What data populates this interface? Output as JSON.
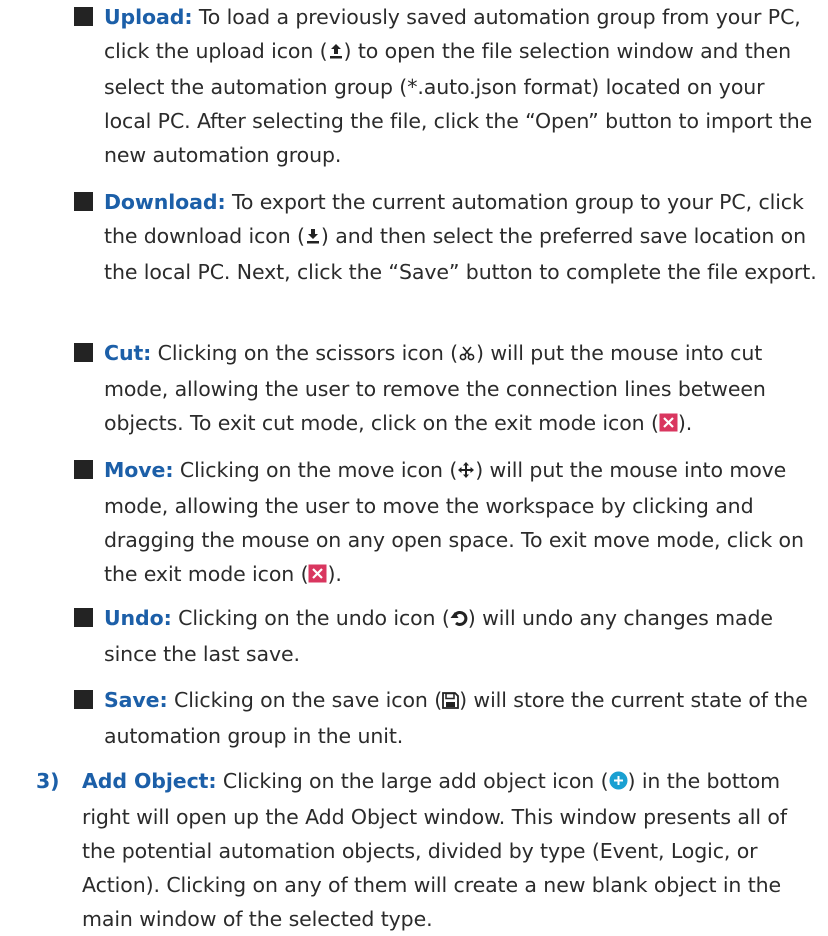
{
  "items": [
    {
      "term": "Upload:",
      "text_before": " To load a previously saved automation group from your PC, click the upload icon (",
      "text_after": ") to open the file selection window and then select the automation group (*.auto.json format) located on your local PC. After selecting the file, click the “Open” button to import the new automation group.",
      "icon": "upload-icon"
    },
    {
      "term": "Download:",
      "text_before": " To export the current automation group to your PC, click the download icon (",
      "text_after": ") and then select the preferred save location on the local PC. Next, click the “Save” button to complete the file export.",
      "icon": "download-icon"
    },
    {
      "term": "Cut:",
      "text_before": " Clicking on the scissors icon (",
      "text_mid": ") will put the mouse into cut mode, allowing the user to remove the connection lines between objects. To exit cut mode, click on the exit mode icon (",
      "text_after": ").",
      "icon": "scissors-icon",
      "icon2": "exit-mode-icon"
    },
    {
      "term": "Move:",
      "text_before": " Clicking on the move icon (",
      "text_mid": ") will put the mouse into move mode, allowing the user to move the workspace by clicking and dragging the mouse on any open space. To exit move mode, click on the exit mode icon (",
      "text_after": ").",
      "icon": "move-icon",
      "icon2": "exit-mode-icon"
    },
    {
      "term": "Undo:",
      "text_before": " Clicking on the undo icon (",
      "text_after": ") will undo any changes made since the last save.",
      "icon": "undo-icon"
    },
    {
      "term": "Save:",
      "text_before": " Clicking on the save icon (",
      "text_after": ") will store the current state of the automation group in the unit.",
      "icon": "save-icon"
    }
  ],
  "numbered": {
    "number": "3)",
    "term": "Add Object:",
    "text_before": " Clicking on the large add object icon (",
    "text_after": ") in the bottom right will open up the Add Object window. This window presents all of the potential automation objects, divided by type (Event, Logic, or Action). Clicking on any of them will create a new blank object in the main window of the selected type.",
    "icon": "add-object-icon"
  },
  "colors": {
    "accent": "#1c5fa8",
    "text": "#2b2b2b",
    "bullet": "#232323",
    "exit_icon": "#d9365f",
    "add_icon": "#1aa0d2"
  }
}
